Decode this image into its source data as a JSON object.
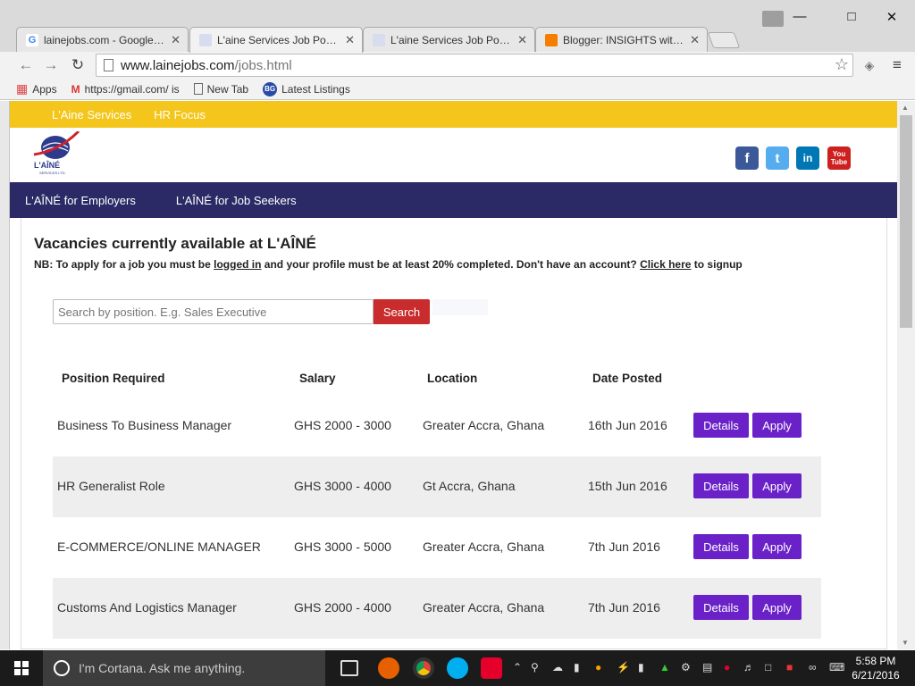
{
  "browser": {
    "tabs": [
      {
        "title": "lainejobs.com - Google Se",
        "favicon": "google-icon",
        "active": false
      },
      {
        "title": "L'aine Services Job Portal",
        "favicon": "laine-icon",
        "active": true
      },
      {
        "title": "L'aine Services Job Portal",
        "favicon": "laine-icon",
        "active": false
      },
      {
        "title": "Blogger: INSIGHTS with D",
        "favicon": "blogger-icon",
        "active": false
      }
    ],
    "url_host": "www.lainejobs.com",
    "url_path": "/jobs.html",
    "bookmarks": [
      {
        "label": "Apps",
        "icon": "apps-grid-icon"
      },
      {
        "label": "https://gmail.com/ is",
        "icon": "gmail-icon"
      },
      {
        "label": "New Tab",
        "icon": "page-icon"
      },
      {
        "label": "Latest Listings",
        "icon": "bg-icon"
      }
    ]
  },
  "site": {
    "topbar": [
      "L'Aine Services",
      "HR Focus"
    ],
    "logo_text": "L'AÎNÉ",
    "logo_sub": "SERVICES LTD.",
    "social": [
      {
        "name": "facebook-icon",
        "glyph": "f",
        "color": "#3b5998"
      },
      {
        "name": "twitter-icon",
        "glyph": "t",
        "color": "#55acee"
      },
      {
        "name": "linkedin-icon",
        "glyph": "in",
        "color": "#0077b5"
      },
      {
        "name": "youtube-icon",
        "glyph": "You Tube",
        "color": "#cd201f"
      }
    ],
    "mainnav": [
      "L'AÎNÉ for Employers",
      "L'AÎNÉ for Job Seekers"
    ]
  },
  "vacancies": {
    "title": "Vacancies currently available at L'AÎNÉ",
    "nb_prefix": "NB: To apply for a job you must be ",
    "nb_link1": "logged in",
    "nb_middle": " and your profile must be at least 20% completed. Don't have an account? ",
    "nb_link2": "Click here",
    "nb_suffix": " to signup",
    "search_placeholder": "Search by position. E.g. Sales Executive",
    "search_label": "Search",
    "columns": [
      "Position Required",
      "Salary",
      "Location",
      "Date Posted"
    ],
    "details_label": "Details",
    "apply_label": "Apply",
    "rows": [
      {
        "position": "Business To Business Manager",
        "salary": "GHS 2000 - 3000",
        "location": "Greater Accra, Ghana",
        "date": "16th Jun 2016"
      },
      {
        "position": "HR Generalist Role",
        "salary": "GHS 3000 - 4000",
        "location": "Gt Accra, Ghana",
        "date": "15th Jun 2016"
      },
      {
        "position": "E-COMMERCE/ONLINE MANAGER",
        "salary": "GHS 3000 - 5000",
        "location": "Greater Accra, Ghana",
        "date": "7th Jun 2016"
      },
      {
        "position": "Customs And Logistics Manager",
        "salary": "GHS 2000 - 4000",
        "location": "Greater Accra, Ghana",
        "date": "7th Jun 2016"
      }
    ]
  },
  "taskbar": {
    "cortana_text": "I'm Cortana. Ask me anything.",
    "time": "5:58 PM",
    "date": "6/21/2016"
  }
}
